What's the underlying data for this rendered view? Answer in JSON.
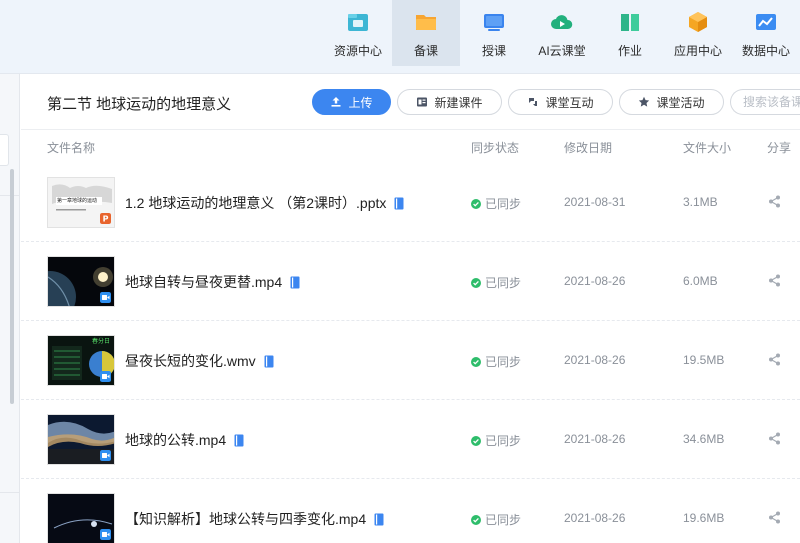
{
  "nav": {
    "items": [
      {
        "label": "资源中心",
        "icon": "folder-box-icon",
        "active": false
      },
      {
        "label": "备课",
        "icon": "folder-icon",
        "active": true
      },
      {
        "label": "授课",
        "icon": "monitor-icon",
        "active": false
      },
      {
        "label": "AI云课堂",
        "icon": "cloud-play-icon",
        "active": false
      },
      {
        "label": "作业",
        "icon": "book-icon",
        "active": false
      },
      {
        "label": "应用中心",
        "icon": "cube-icon",
        "active": false
      },
      {
        "label": "数据中心",
        "icon": "chart-icon",
        "active": false
      }
    ]
  },
  "header": {
    "title": "第二节 地球运动的地理意义",
    "upload_label": "上传",
    "new_courseware_label": "新建课件",
    "class_interaction_label": "课堂互动",
    "class_activity_label": "课堂活动",
    "search_placeholder": "搜索该备课"
  },
  "table": {
    "columns": {
      "name": "文件名称",
      "sync": "同步状态",
      "date": "修改日期",
      "size": "文件大小",
      "share": "分享"
    },
    "rows": [
      {
        "name": "1.2 地球运动的地理意义 （第2课时）.pptx",
        "sync": "已同步",
        "date": "2021-08-31",
        "size": "3.1MB",
        "type": "pptx"
      },
      {
        "name": "地球自转与昼夜更替.mp4",
        "sync": "已同步",
        "date": "2021-08-26",
        "size": "6.0MB",
        "type": "video"
      },
      {
        "name": "昼夜长短的变化.wmv",
        "sync": "已同步",
        "date": "2021-08-26",
        "size": "19.5MB",
        "type": "video"
      },
      {
        "name": "地球的公转.mp4",
        "sync": "已同步",
        "date": "2021-08-26",
        "size": "34.6MB",
        "type": "video"
      },
      {
        "name": "【知识解析】地球公转与四季变化.mp4",
        "sync": "已同步",
        "date": "2021-08-26",
        "size": "19.6MB",
        "type": "video"
      }
    ]
  },
  "thumbnails": {
    "row0_text": "第一章地球的运动",
    "row2_text": "春分日"
  },
  "colors": {
    "accent": "#3c86f0",
    "sync_ok": "#2ebd6b",
    "ppt_badge": "#e8642d",
    "video_badge": "#2e8ff0"
  }
}
